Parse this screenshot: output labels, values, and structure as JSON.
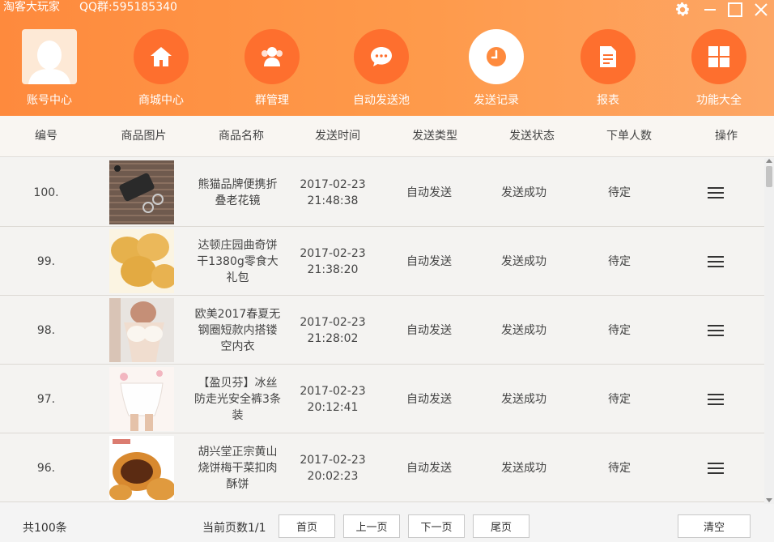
{
  "app": {
    "title": "淘客大玩家",
    "qq_group": "QQ群:595185340"
  },
  "window_controls": [
    "gear-icon",
    "minimize-icon",
    "maximize-icon",
    "close-icon"
  ],
  "nav": [
    {
      "label": "账号中心",
      "icon": "avatar",
      "active": false
    },
    {
      "label": "商城中心",
      "icon": "home-icon",
      "active": false
    },
    {
      "label": "群管理",
      "icon": "group-icon",
      "active": false
    },
    {
      "label": "自动发送池",
      "icon": "chat-bubble-icon",
      "active": false
    },
    {
      "label": "发送记录",
      "icon": "clock-icon",
      "active": true
    },
    {
      "label": "报表",
      "icon": "document-icon",
      "active": false
    },
    {
      "label": "功能大全",
      "icon": "grid-icon",
      "active": false
    }
  ],
  "table": {
    "headers": [
      "编号",
      "商品图片",
      "商品名称",
      "发送时间",
      "发送类型",
      "发送状态",
      "下单人数",
      "操作"
    ],
    "rows": [
      {
        "id": "100.",
        "image": "glasses-case-photo",
        "name": "熊猫品牌便携折叠老花镜",
        "date": "2017-02-23",
        "time": "21:48:38",
        "type": "自动发送",
        "status": "发送成功",
        "orders": "待定"
      },
      {
        "id": "99.",
        "image": "cookies-photo",
        "name": "达顿庄园曲奇饼干1380g零食大礼包",
        "date": "2017-02-23",
        "time": "21:38:20",
        "type": "自动发送",
        "status": "发送成功",
        "orders": "待定"
      },
      {
        "id": "98.",
        "image": "lingerie-photo",
        "name": "欧美2017春夏无钢圈短款内搭镂空内衣",
        "date": "2017-02-23",
        "time": "21:28:02",
        "type": "自动发送",
        "status": "发送成功",
        "orders": "待定"
      },
      {
        "id": "97.",
        "image": "safety-shorts-photo",
        "name": "【盈贝芬】冰丝防走光安全裤3条装",
        "date": "2017-02-23",
        "time": "20:12:41",
        "type": "自动发送",
        "status": "发送成功",
        "orders": "待定"
      },
      {
        "id": "96.",
        "image": "pastry-photo",
        "name": "胡兴堂正宗黄山烧饼梅干菜扣肉酥饼",
        "date": "2017-02-23",
        "time": "20:02:23",
        "type": "自动发送",
        "status": "发送成功",
        "orders": "待定"
      }
    ]
  },
  "footer": {
    "total": "共100条",
    "page_info": "当前页数1/1",
    "first": "首页",
    "prev": "上一页",
    "next": "下一页",
    "last": "尾页",
    "clear": "清空"
  },
  "colors": {
    "header_start": "#fe8a3d",
    "header_end": "#fda665",
    "nav_circle": "#fe6f2e",
    "active_circle": "#ffffff"
  }
}
